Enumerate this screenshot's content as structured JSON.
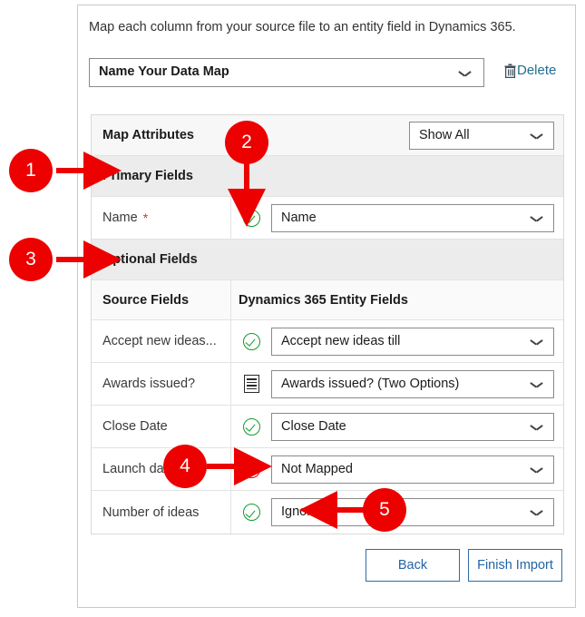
{
  "dialog": {
    "instruction": "Map each column from your source file to an entity field in Dynamics 365.",
    "datamap": {
      "value": "Name Your Data Map",
      "chevron_icon": "chevron-down-icon"
    },
    "delete": {
      "label": "Delete",
      "icon": "trash-icon",
      "color": "#1f6f8f"
    }
  },
  "table": {
    "map_attributes_header": {
      "label": "Map Attributes",
      "filter": {
        "value": "Show All",
        "chevron_icon": "chevron-down-icon"
      }
    },
    "primary_group_label": "Primary Fields",
    "primary_rows": [
      {
        "source": "Name",
        "required_marker": "*",
        "status_icon": "green-check-icon",
        "mapped_value": "Name"
      }
    ],
    "optional_group_label": "Optional Fields",
    "column_headers": {
      "source": "Source Fields",
      "target": "Dynamics 365 Entity Fields"
    },
    "optional_rows": [
      {
        "source": "Accept new ideas...",
        "status_icon": "green-check-icon",
        "mapped_value": "Accept new ideas till"
      },
      {
        "source": "Awards issued?",
        "status_icon": "list-options-icon",
        "mapped_value": "Awards issued? (Two Options)"
      },
      {
        "source": "Close Date",
        "status_icon": "green-check-icon",
        "mapped_value": "Close Date"
      },
      {
        "source": "Launch date",
        "status_icon": "red-warning-icon",
        "mapped_value": "Not Mapped"
      },
      {
        "source": "Number of ideas",
        "status_icon": "green-check-icon",
        "mapped_value": "Ignore"
      }
    ]
  },
  "footer": {
    "back_label": "Back",
    "finish_label": "Finish Import"
  },
  "annotations": {
    "accent_color": "#ec0000",
    "items": [
      {
        "number": "1",
        "target": "Primary Fields group row"
      },
      {
        "number": "2",
        "target": "Name row status check icon"
      },
      {
        "number": "3",
        "target": "Optional Fields group row"
      },
      {
        "number": "4",
        "target": "Launch date warning icon"
      },
      {
        "number": "5",
        "target": "Ignore mapped value"
      }
    ]
  }
}
